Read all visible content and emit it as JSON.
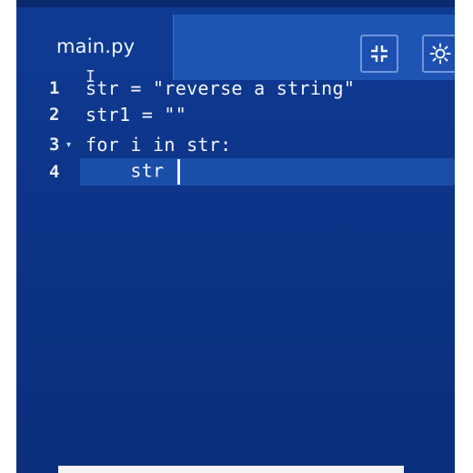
{
  "tab": {
    "filename": "main.py"
  },
  "toolbar": {
    "collapse_icon": "collapse-icon",
    "theme_icon": "sun-icon"
  },
  "editor": {
    "lines": [
      {
        "number": "1",
        "text": "str = \"reverse a string\""
      },
      {
        "number": "2",
        "text": "str1 = \"\""
      },
      {
        "number": "3",
        "text": "for i in str:",
        "foldable": true
      },
      {
        "number": "4",
        "text": "    str "
      }
    ]
  },
  "colors": {
    "editor_background": "#0d3488",
    "tab_background": "#1e55b5",
    "current_line": "#1a4fa8",
    "text": "#f4f7ff"
  }
}
